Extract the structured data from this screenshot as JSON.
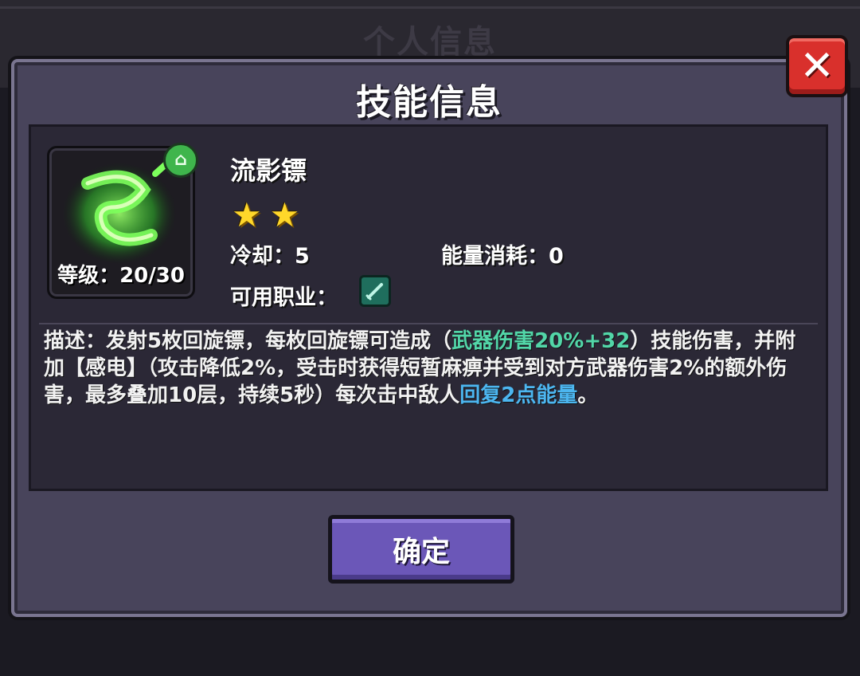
{
  "background": {
    "title": "个人信息"
  },
  "dialog": {
    "title": "技能信息",
    "close_label": "✕",
    "confirm_label": "确定"
  },
  "skill": {
    "name": "流影镖",
    "stars": 2,
    "level_text": "等级：20/30",
    "cooldown_text": "冷却：5",
    "energy_text": "能量消耗：0",
    "class_label": "可用职业：",
    "icon": "green-boomerang-icon",
    "class_icon": "sword-icon",
    "description": {
      "part1": "描述：发射5枚回旋镖，每枚回旋镖可造成（",
      "highlight1": "武器伤害20%+32",
      "part2": "）技能伤害，并附加【感电】（攻击降低2%，受击时获得短暂麻痹并受到对方武器伤害2%的额外伤害，最多叠加10层，持续5秒）每次击中敌人",
      "highlight2": "回复2点能量",
      "part3": "。"
    }
  },
  "colors": {
    "highlight_green": "#52d6a8",
    "highlight_blue": "#4cb6f0",
    "star": "#ffd72a",
    "close_button": "#d9302c",
    "confirm_button": "#6b57b8"
  }
}
